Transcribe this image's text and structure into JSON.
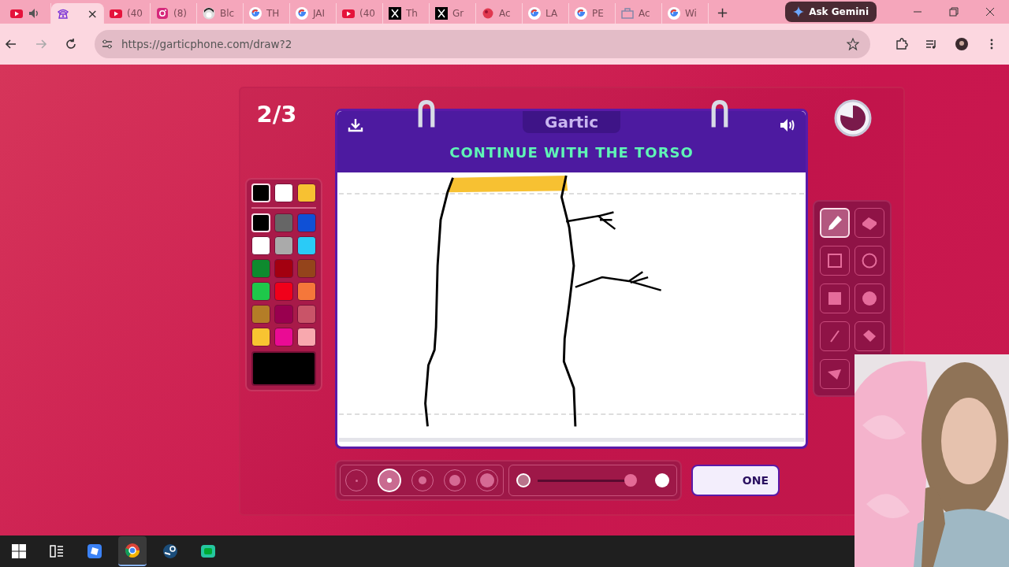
{
  "browser": {
    "tabs": [
      {
        "kind": "youtube",
        "audio": true,
        "selected": false
      },
      {
        "kind": "phone",
        "audio": false,
        "selected": true,
        "close": "×"
      },
      {
        "kind": "youtube",
        "label": "(40",
        "audio": false,
        "selected": false
      },
      {
        "kind": "instagram",
        "label": "(8)",
        "audio": false,
        "selected": false
      },
      {
        "kind": "avatar",
        "label": "Blc",
        "audio": false,
        "selected": false
      },
      {
        "kind": "google",
        "label": "TH",
        "audio": false,
        "selected": false
      },
      {
        "kind": "google",
        "label": "JAI",
        "audio": false,
        "selected": false
      },
      {
        "kind": "youtube",
        "label": "(40",
        "audio": false,
        "selected": false
      },
      {
        "kind": "x",
        "label": "Th",
        "audio": false,
        "selected": false
      },
      {
        "kind": "x",
        "label": "Gr",
        "audio": false,
        "selected": false
      },
      {
        "kind": "blob",
        "label": "Ac",
        "audio": false,
        "selected": false
      },
      {
        "kind": "google",
        "label": "LA",
        "audio": false,
        "selected": false
      },
      {
        "kind": "google",
        "label": "PE",
        "audio": false,
        "selected": false
      },
      {
        "kind": "bag",
        "label": "Ac",
        "audio": false,
        "selected": false
      },
      {
        "kind": "google",
        "label": "Wi",
        "audio": false,
        "selected": false
      }
    ],
    "new_tab": "+",
    "gemini_button": "Ask Gemini",
    "url": "https://garticphone.com/draw?2"
  },
  "game": {
    "round": "2/3",
    "logo": "Gartic",
    "prompt": "CONTINUE WITH THE TORSO",
    "recent_colors": [
      {
        "color": "#000000",
        "selected": true
      },
      {
        "color": "#ffffff",
        "selected": false
      },
      {
        "color": "#f7c132",
        "selected": false
      }
    ],
    "palette": [
      {
        "color": "#000000",
        "selected": true
      },
      {
        "color": "#666666",
        "selected": false
      },
      {
        "color": "#0f50d6",
        "selected": false
      },
      {
        "color": "#ffffff",
        "selected": false
      },
      {
        "color": "#aaaaaa",
        "selected": false
      },
      {
        "color": "#2acbf7",
        "selected": false
      },
      {
        "color": "#0e8a2e",
        "selected": false
      },
      {
        "color": "#a30010",
        "selected": false
      },
      {
        "color": "#94441b",
        "selected": false
      },
      {
        "color": "#1ec84a",
        "selected": false
      },
      {
        "color": "#f0001a",
        "selected": false
      },
      {
        "color": "#f5773a",
        "selected": false
      },
      {
        "color": "#b47d27",
        "selected": false
      },
      {
        "color": "#99004f",
        "selected": false
      },
      {
        "color": "#c95468",
        "selected": false
      },
      {
        "color": "#f8c431",
        "selected": false
      },
      {
        "color": "#ea0b94",
        "selected": false
      },
      {
        "color": "#f8a8ae",
        "selected": false
      }
    ],
    "tools": [
      {
        "kind": "pencil",
        "selected": true
      },
      {
        "kind": "eraser",
        "selected": false
      },
      {
        "kind": "rect",
        "selected": false
      },
      {
        "kind": "ellipse",
        "selected": false
      },
      {
        "kind": "filled-rect",
        "selected": false
      },
      {
        "kind": "filled-ellipse",
        "selected": false
      },
      {
        "kind": "line",
        "selected": false
      },
      {
        "kind": "bucket",
        "selected": false
      },
      {
        "kind": "undo",
        "selected": false
      }
    ],
    "brush_sizes": [
      {
        "selected": false
      },
      {
        "selected": true
      },
      {
        "selected": false
      },
      {
        "selected": false
      },
      {
        "selected": false
      }
    ],
    "opacity": {
      "level": 0.97
    },
    "done_button": "ONE"
  },
  "taskbar": {
    "apps": [
      {
        "kind": "roblox",
        "active": false
      },
      {
        "kind": "chrome",
        "active": true
      },
      {
        "kind": "steam",
        "active": false
      },
      {
        "kind": "green-app",
        "active": false
      }
    ]
  }
}
